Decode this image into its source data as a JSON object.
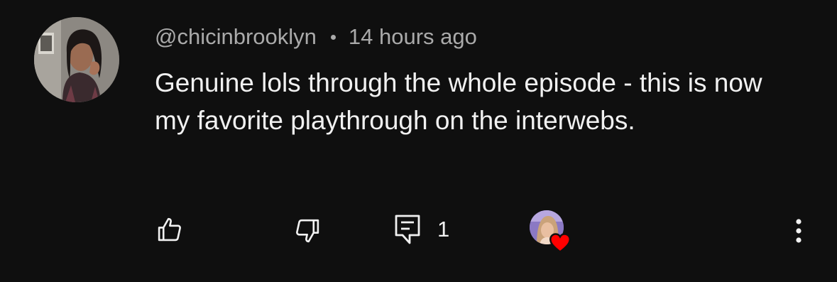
{
  "comment": {
    "author": "@chicinbrooklyn",
    "timestamp": "14 hours ago",
    "text": "Genuine lols through the whole episode - this is now my favorite playthrough on the interwebs.",
    "reply_count": "1"
  },
  "icons": {
    "like": "thumbs-up-icon",
    "dislike": "thumbs-down-icon",
    "reply": "comment-reply-icon",
    "creator_heart": "heart-icon",
    "more": "more-vert-icon"
  },
  "colors": {
    "background": "#0f0f0f",
    "text_primary": "#f1f1f1",
    "text_secondary": "#aaaaaa",
    "heart": "#ff0000"
  }
}
